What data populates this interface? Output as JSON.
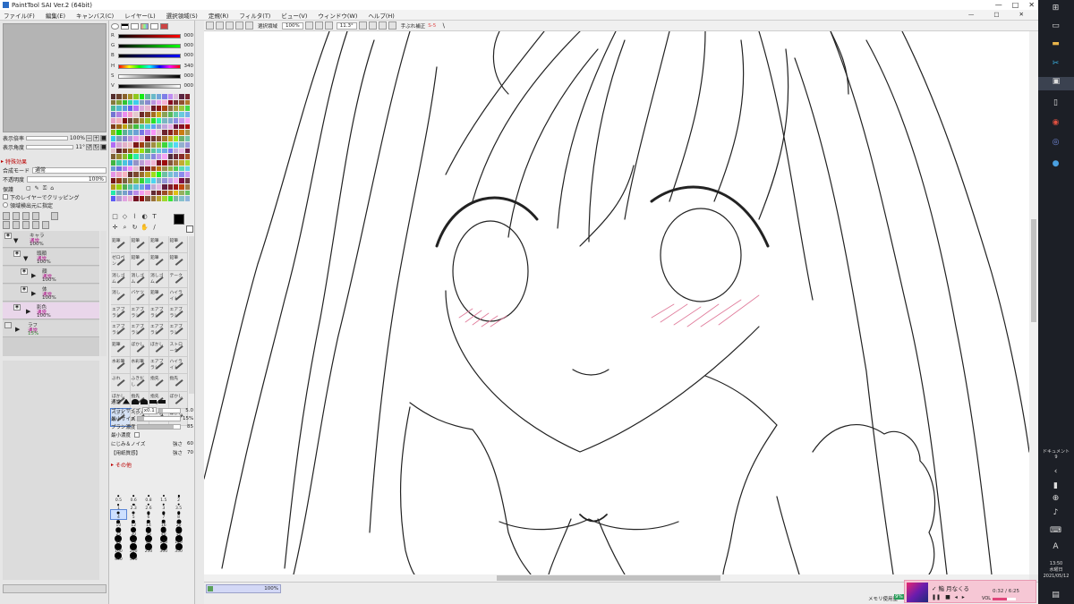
{
  "window": {
    "title": "PaintTool SAI Ver.2 (64bit)",
    "controls": [
      "—",
      "□",
      "✕"
    ]
  },
  "menu": [
    "ファイル(F)",
    "編集(E)",
    "キャンバス(C)",
    "レイヤー(L)",
    "選択領域(S)",
    "定規(R)",
    "フィルタ(T)",
    "ビュー(V)",
    "ウィンドウ(W)",
    "ヘルプ(H)"
  ],
  "navigator": {
    "zoom_label": "表示倍率",
    "zoom_value": "100%",
    "angle_label": "表示角度",
    "angle_value": "11°"
  },
  "layer_props": {
    "effects_label": "特殊効果",
    "blend_label": "合成モード",
    "blend_value": "通常",
    "opacity_label": "不透明度",
    "opacity_value": "100%",
    "protect_label": "保護",
    "clip_label": "下のレイヤーでクリッピング",
    "select_source_label": "領域検出元に指定"
  },
  "layers": [
    {
      "name": "キャラ",
      "mode": "通常",
      "opacity": "100%",
      "selected": false
    },
    {
      "name": "頭顔",
      "mode": "通常",
      "opacity": "100%",
      "selected": false
    },
    {
      "name": "顔",
      "mode": "通常",
      "opacity": "100%",
      "selected": false
    },
    {
      "name": "体",
      "mode": "通常",
      "opacity": "100%",
      "selected": false
    },
    {
      "name": "影色",
      "mode": "通常",
      "opacity": "100%",
      "selected": true
    },
    {
      "name": "ラフ",
      "mode": "通常",
      "opacity": "15%",
      "selected": false
    }
  ],
  "color_sliders": [
    {
      "label": "R",
      "value": "000",
      "gradient": "linear-gradient(90deg,#000,#f00)"
    },
    {
      "label": "G",
      "value": "000",
      "gradient": "linear-gradient(90deg,#000,#0f0)"
    },
    {
      "label": "B",
      "value": "000",
      "gradient": "linear-gradient(90deg,#000,#00f)"
    },
    {
      "label": "H",
      "value": "340",
      "gradient": "linear-gradient(90deg,#f00,#ff0,#0f0,#0ff,#00f,#f0f,#f00)"
    },
    {
      "label": "S",
      "value": "000",
      "gradient": "linear-gradient(90deg,#fff,#000)"
    },
    {
      "label": "V",
      "value": "000",
      "gradient": "linear-gradient(90deg,#000,#fff)"
    }
  ],
  "tool_buttons": [
    "□",
    "◇",
    "⌇",
    "◐",
    "T",
    "✛",
    "⌕",
    "↻",
    "✋",
    "∕"
  ],
  "brushes": [
    "鉛筆",
    "鉛筆",
    "鉛筆",
    "鉛筆",
    "ゼロペン",
    "鉛筆",
    "鉛筆",
    "鉛筆",
    "消しゴム",
    "消しゴム",
    "消しゴム",
    "テーク",
    "消し",
    "バケツ",
    "鉛筆",
    "ハイライト",
    "エアブラシ",
    "エアブラシ",
    "エアブラシ",
    "エアブラシ",
    "エアブラシ",
    "エアブラシ",
    "エアブラシ",
    "エアブラシ",
    "鉛筆",
    "ぼかし",
    "ぼかし",
    "ストローク",
    "水彩筆",
    "水彩筆",
    "エアブラシ",
    "ハイライト",
    "ぶれ",
    "ふきだし",
    "指先",
    "指先",
    "ぼかし",
    "指先",
    "指先",
    "ぼかし",
    "ペン入れ",
    "ペン入れ",
    "ペン消し",
    "ぼかし"
  ],
  "brush_selected_index": 40,
  "brush_params": {
    "mode_label": "通常",
    "size_label": "ブラシサイズ",
    "size_mult": "x0.1",
    "size_value": "5.0",
    "min_label": "最小サイズ",
    "min_value": "15%",
    "density_label": "ブラシ濃度",
    "density_value": "85",
    "min_density_label": "最小濃度",
    "blend_label": "にじみ＆ノイズ",
    "blend_value_label": "強さ",
    "blend_value": "60",
    "paper_label": "【用紙質感】",
    "paper_value_label": "強さ",
    "paper_value": "70",
    "other_label": "その他"
  },
  "brush_sizes": [
    "0.5",
    "0.6",
    "0.8",
    "1.5",
    "2",
    "1",
    "2.3",
    "2.6",
    "3",
    "3.5",
    "4",
    "5",
    "6",
    "7",
    "8",
    "10",
    "12",
    "14",
    "16",
    "20",
    "25",
    "30",
    "35",
    "40",
    "50",
    "60",
    "70",
    "80",
    "100",
    "120",
    "160",
    "200",
    "250",
    "300",
    "350",
    "400",
    "500"
  ],
  "brush_size_selected_index": 10,
  "canvas_toolbar": {
    "select_label": "選択領域",
    "zoom": "100%",
    "angle": "11.3°",
    "stabilizer_label": "手ぶれ補正",
    "stabilizer_value": "S-5"
  },
  "status": {
    "doc_zoom": "100%",
    "memory_label": "メモリ使用量",
    "memory_value": "9%"
  },
  "media": {
    "title": "✓ 鮨 月なくる",
    "time": "0:32 / 6:25",
    "vol_label": "VOL",
    "volume": 0.6
  },
  "taskbar": {
    "doc_label": "ドキュメント",
    "doc_count": "9",
    "time": "13:50",
    "day": "水曜日",
    "date": "2021/05/12"
  },
  "colors": {
    "accent": "#4a7bd0",
    "mode_text": "#b0158a",
    "section_red": "#b00000"
  }
}
